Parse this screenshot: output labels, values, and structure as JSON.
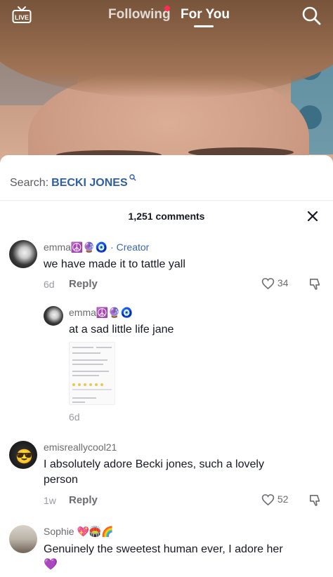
{
  "nav": {
    "live_label": "LIVE",
    "tab_following": "Following",
    "tab_foryou": "For You",
    "search_icon": "search-icon",
    "notification_color": "#fe2c55"
  },
  "sheet": {
    "search_label": "Search:",
    "search_term": "BECKI JONES",
    "comment_count": "1,251 comments",
    "close_icon": "close-icon",
    "comments": [
      {
        "username": "emma",
        "badges": "☮️🔮🧿",
        "creator_label": "· Creator",
        "text": "we have made it to tattle yall",
        "age": "6d",
        "reply_label": "Reply",
        "likes": "34"
      },
      {
        "username": "emma",
        "badges": "☮️🔮🧿",
        "text": "at a sad little life jane",
        "age": "6d"
      },
      {
        "username": "emisreallycool21",
        "text_line1": "I absolutely adore Becki jones, such a lovely",
        "text_line2": "person",
        "age": "1w",
        "reply_label": "Reply",
        "likes": "52"
      },
      {
        "username": "Sophie",
        "badges": "💖🏟️🌈",
        "text_line1": "Genuinely the sweetest human ever, I adore her",
        "text_line2": "💜"
      }
    ]
  }
}
